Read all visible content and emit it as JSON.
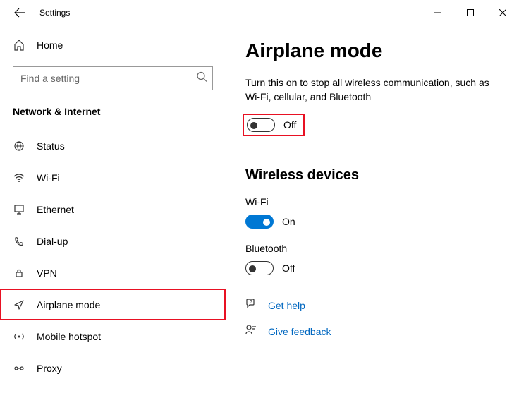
{
  "window": {
    "title": "Settings"
  },
  "sidebar": {
    "home": "Home",
    "search_placeholder": "Find a setting",
    "category": "Network & Internet",
    "items": [
      {
        "label": "Status"
      },
      {
        "label": "Wi-Fi"
      },
      {
        "label": "Ethernet"
      },
      {
        "label": "Dial-up"
      },
      {
        "label": "VPN"
      },
      {
        "label": "Airplane mode"
      },
      {
        "label": "Mobile hotspot"
      },
      {
        "label": "Proxy"
      }
    ]
  },
  "content": {
    "title": "Airplane mode",
    "description": "Turn this on to stop all wireless communication, such as Wi-Fi, cellular, and Bluetooth",
    "airplane_toggle": {
      "state": "Off"
    },
    "wireless_section": "Wireless devices",
    "wifi": {
      "label": "Wi-Fi",
      "state": "On"
    },
    "bluetooth": {
      "label": "Bluetooth",
      "state": "Off"
    },
    "help_link": "Get help",
    "feedback_link": "Give feedback"
  }
}
